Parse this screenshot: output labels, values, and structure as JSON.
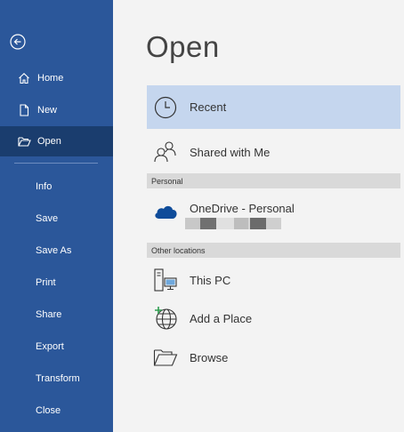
{
  "sidebar": {
    "back_icon": "back-arrow-icon",
    "items": [
      {
        "label": "Home",
        "icon": "home-icon"
      },
      {
        "label": "New",
        "icon": "new-document-icon"
      },
      {
        "label": "Open",
        "icon": "open-folder-icon",
        "active": true
      },
      {
        "label": "Info"
      },
      {
        "label": "Save"
      },
      {
        "label": "Save As"
      },
      {
        "label": "Print"
      },
      {
        "label": "Share"
      },
      {
        "label": "Export"
      },
      {
        "label": "Transform"
      },
      {
        "label": "Close"
      }
    ]
  },
  "main": {
    "title": "Open",
    "recent_label": "Recent",
    "shared_label": "Shared with Me",
    "personal_header": "Personal",
    "onedrive_label": "OneDrive - Personal",
    "other_header": "Other locations",
    "thispc_label": "This PC",
    "addplace_label": "Add a Place",
    "browse_label": "Browse"
  },
  "colors": {
    "sidebar_bg": "#2b579a",
    "sidebar_active": "#1a3d6e",
    "selected_row": "#c5d6ee",
    "onedrive_blue": "#0f4c9a"
  }
}
